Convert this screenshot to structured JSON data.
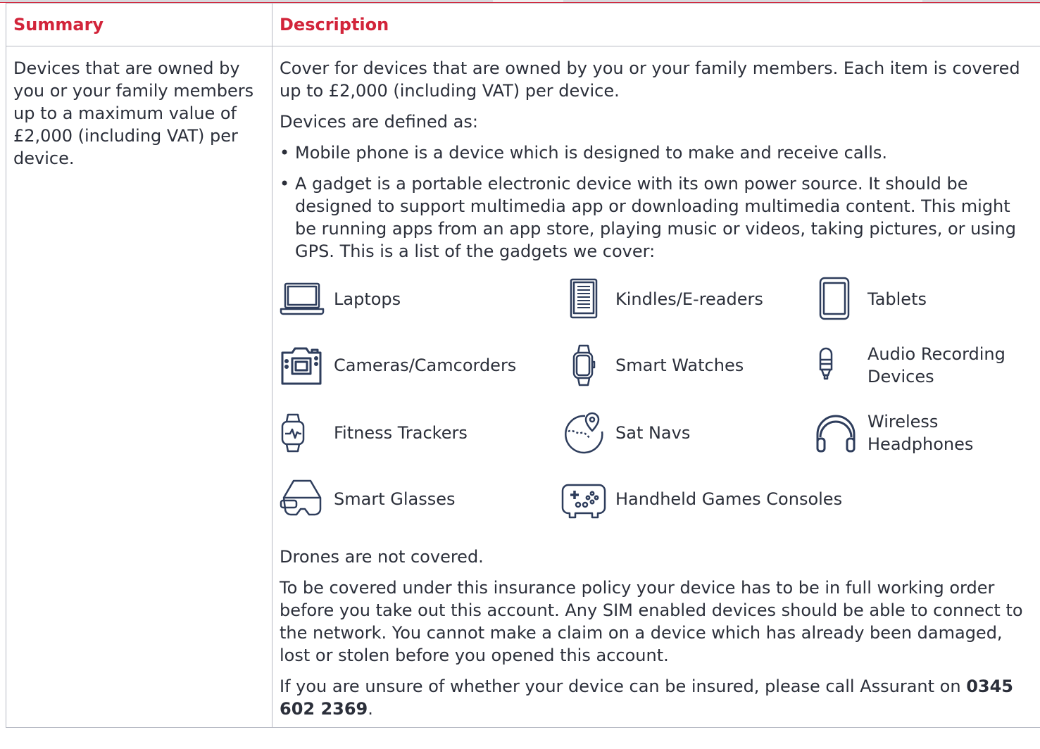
{
  "table": {
    "header_summary": "Summary",
    "header_description": "Description"
  },
  "summary_text": "Devices that are owned by you or your family members up to a maximum value of £2,000 (including VAT) per device.",
  "description": {
    "intro": "Cover for devices that are owned by you or your family members. Each item is covered up to £2,000 (including VAT) per device.",
    "defined_as": "Devices are defined as:",
    "bullet_marker": "•",
    "bullets": [
      "Mobile phone is a device which is designed to make and receive calls.",
      "A gadget is a portable electronic device with its own power source. It should be designed to support multimedia app or downloading multimedia content. This might be running apps from an app store, playing music or videos, taking pictures, or using GPS. This is a list of the gadgets we cover:"
    ],
    "gadgets": [
      {
        "label": "Laptops",
        "icon": "laptop-icon"
      },
      {
        "label": "Kindles/E-readers",
        "icon": "ereader-icon"
      },
      {
        "label": "Tablets",
        "icon": "tablet-icon"
      },
      {
        "label": "Cameras/Camcorders",
        "icon": "camera-icon"
      },
      {
        "label": "Smart Watches",
        "icon": "smartwatch-icon"
      },
      {
        "label": "Audio Recording Devices",
        "icon": "microphone-icon"
      },
      {
        "label": "Fitness Trackers",
        "icon": "fitness-tracker-icon"
      },
      {
        "label": "Sat Navs",
        "icon": "sat-nav-icon"
      },
      {
        "label": "Wireless Headphones",
        "icon": "headphones-icon"
      },
      {
        "label": "Smart Glasses",
        "icon": "smart-glasses-icon"
      },
      {
        "label": "Handheld Games Consoles",
        "icon": "game-controller-icon"
      }
    ],
    "drones": "Drones are not covered.",
    "working_order": "To be covered under this insurance policy your device has to be in full working order before you take out this account. Any SIM enabled devices should be able to connect to the network. You cannot make a claim on a device which has already been damaged, lost or stolen before you opened this account.",
    "unsure_prefix": "If you are unsure of whether your device can be insured, please call Assurant on ",
    "phone": "0345 602 2369",
    "unsure_suffix": "."
  },
  "colors": {
    "accent": "#d2243a",
    "icon": "#2e3d5c",
    "text": "#2b2f3a",
    "border": "#b6b9c3"
  }
}
